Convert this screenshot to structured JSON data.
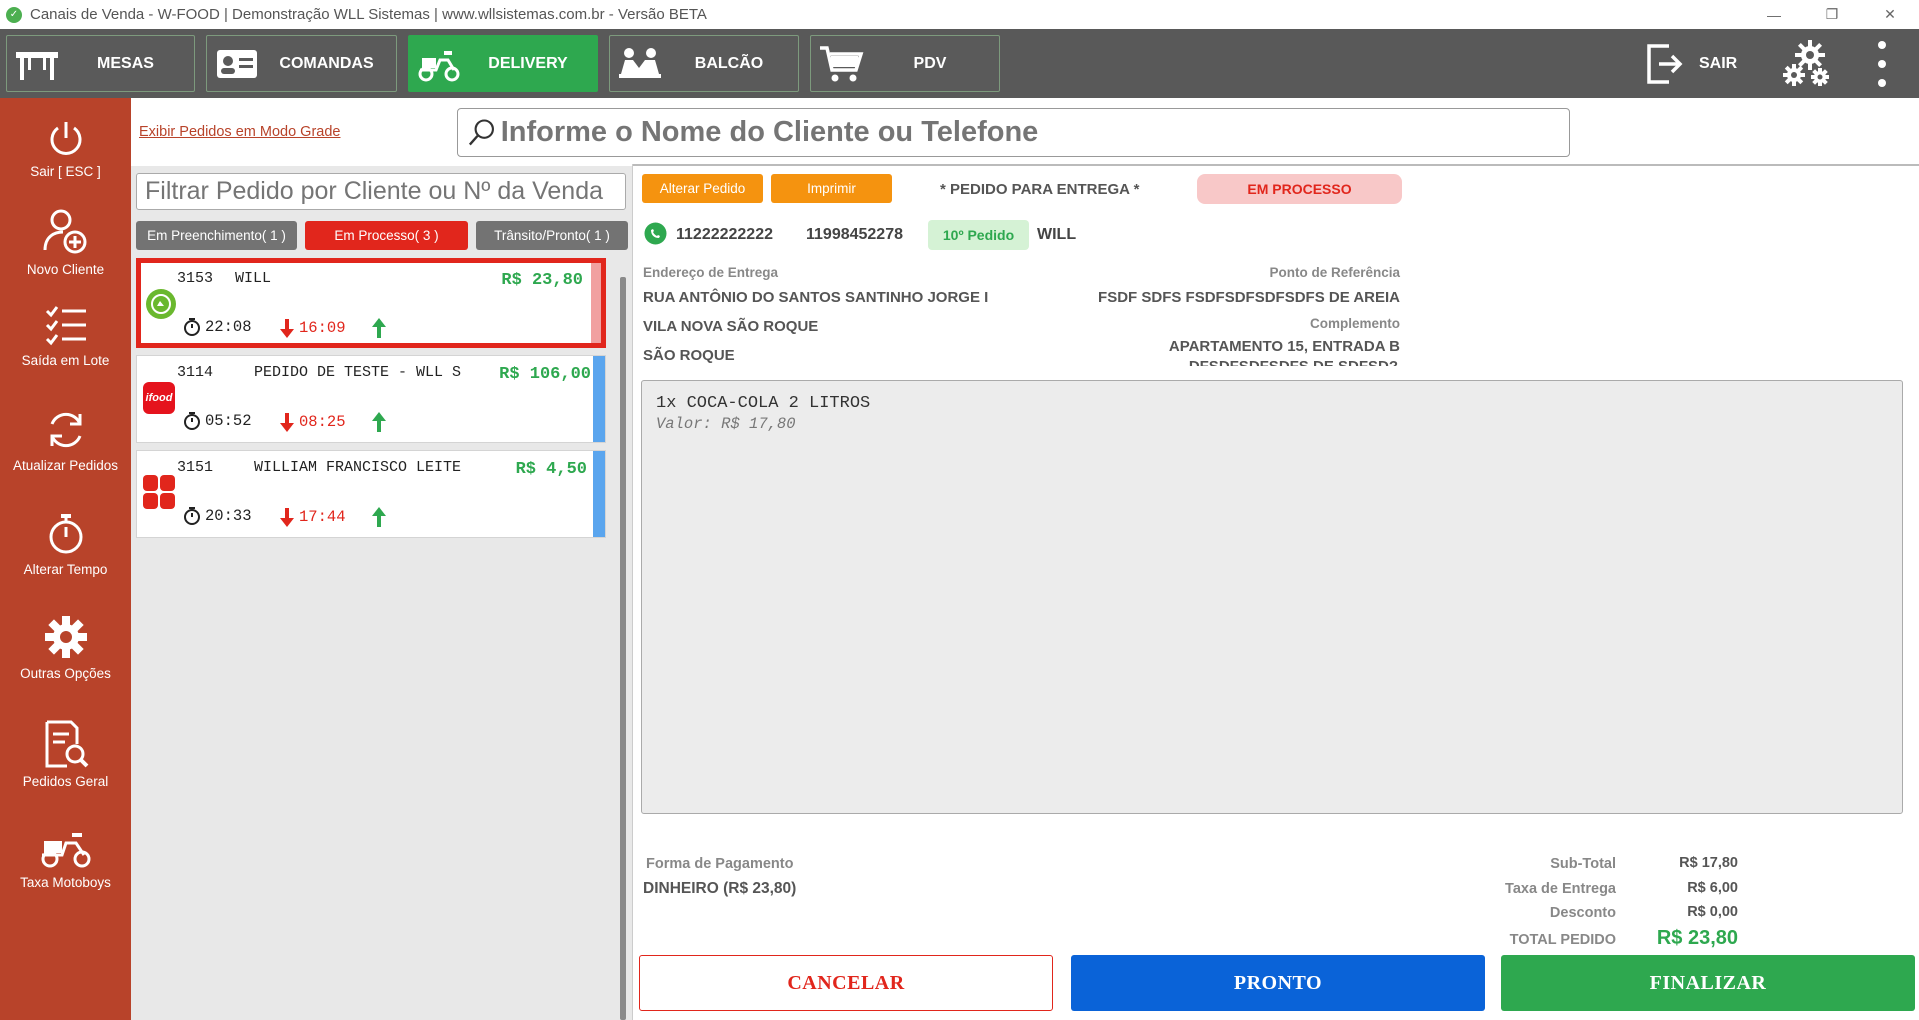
{
  "window": {
    "title": "Canais de Venda - W-FOOD | Demonstração WLL Sistemas | www.wllsistemas.com.br - Versão BETA",
    "minimize": "—",
    "restore": "❐",
    "close": "✕"
  },
  "nav": {
    "mesas": "MESAS",
    "comandas": "COMANDAS",
    "delivery": "DELIVERY",
    "balcao": "BALCÃO",
    "pdv": "PDV",
    "sair": "SAIR"
  },
  "sidebar": {
    "items": [
      {
        "label": "Sair  [ ESC ]",
        "icon": "power-icon"
      },
      {
        "label": "Novo Cliente",
        "icon": "add-user-icon"
      },
      {
        "label": "Saída em Lote",
        "icon": "checklist-icon"
      },
      {
        "label": "Atualizar Pedidos",
        "icon": "refresh-icon"
      },
      {
        "label": "Alterar Tempo",
        "icon": "stopwatch-icon"
      },
      {
        "label": "Outras Opções",
        "icon": "gear-icon"
      },
      {
        "label": "Pedidos Geral",
        "icon": "document-search-icon"
      },
      {
        "label": "Taxa Motoboys",
        "icon": "scooter-icon"
      }
    ]
  },
  "left": {
    "grade_link": "Exibir Pedidos em Modo Grade",
    "filter_placeholder": "Filtrar Pedido por Cliente ou Nº da Venda",
    "tabs": {
      "preenchimento": "Em Preenchimento( 1 )",
      "processo": "Em Processo( 3 )",
      "transito": "Trânsito/Pronto( 1 )"
    },
    "orders": [
      {
        "num": "3153",
        "name": "WILL",
        "price": "R$ 23,80",
        "time1": "22:08",
        "time2": "16:09",
        "source": "wfood-icon"
      },
      {
        "num": "3114",
        "name": "PEDIDO DE TESTE - WLL S",
        "price": "R$ 106,00",
        "time1": "05:52",
        "time2": "08:25",
        "source": "ifood-icon"
      },
      {
        "num": "3151",
        "name": "WILLIAM FRANCISCO LEITE",
        "price": "R$ 4,50",
        "time1": "20:33",
        "time2": "17:44",
        "source": "delivery-apps-icon"
      }
    ],
    "ifood_text": "ifood"
  },
  "search": {
    "placeholder": "Informe o Nome do Cliente ou Telefone"
  },
  "detail": {
    "alterar": "Alterar Pedido",
    "imprimir": "Imprimir",
    "tipo": "* PEDIDO PARA ENTREGA *",
    "status": "EM PROCESSO",
    "phone1": "11222222222",
    "phone2": "11998452278",
    "order_count": "10º Pedido",
    "customer": "WILL",
    "addr_label": "Endereço de Entrega",
    "addr_line1": "RUA ANTÔNIO DO SANTOS SANTINHO JORGE I",
    "addr_line2": "VILA NOVA SÃO ROQUE",
    "addr_line3": "SÃO ROQUE",
    "ref_label": "Ponto de Referência",
    "ref_value": "FSDF SDFS FSDFSDFSDFSDFS DE AREIA",
    "comp_label": "Complemento",
    "comp_value": "APARTAMENTO 15, ENTRADA B",
    "comp_value2": "DFSDFSDFSDFS DE SDFSD?",
    "items": [
      {
        "line": "1x COCA-COLA 2 LITROS",
        "value": "Valor: R$ 17,80"
      }
    ],
    "payment_label": "Forma de Pagamento",
    "payment_value": "DINHEIRO (R$ 23,80)",
    "subtotal_label": "Sub-Total",
    "subtotal": "R$ 17,80",
    "taxa_label": "Taxa de Entrega",
    "taxa": "R$ 6,00",
    "desconto_label": "Desconto",
    "desconto": "R$ 0,00",
    "total_label": "TOTAL PEDIDO",
    "total": "R$ 23,80"
  },
  "actions": {
    "cancelar": "CANCELAR",
    "pronto": "PRONTO",
    "finalizar": "FINALIZAR"
  },
  "colors": {
    "sidebar": "#b8432a",
    "accent_green": "#2ea84f",
    "danger": "#e1261c",
    "orange": "#f5930f",
    "blue": "#0a63d8"
  }
}
